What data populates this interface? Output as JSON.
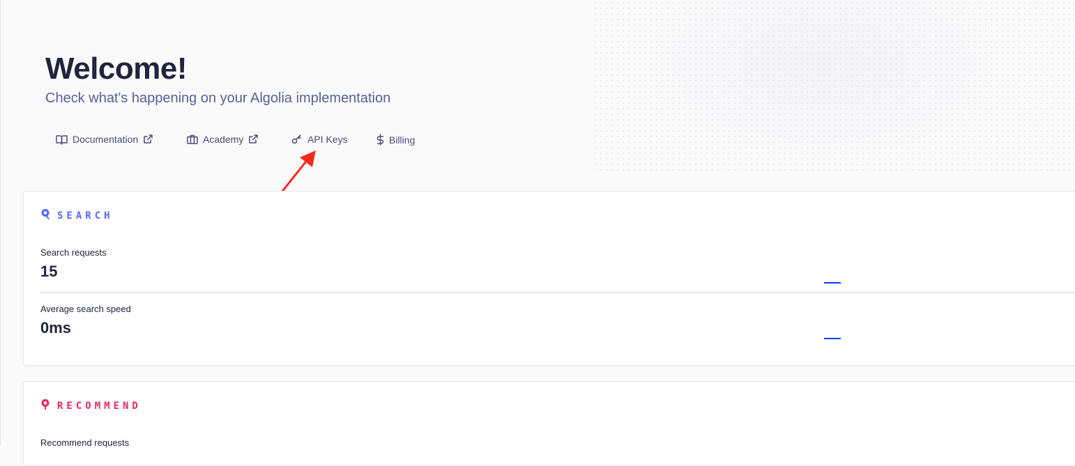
{
  "hero": {
    "title": "Welcome!",
    "subtitle": "Check what's happening on your Algolia implementation"
  },
  "quick_links": [
    {
      "label": "Documentation",
      "icon": "book-icon",
      "external": true
    },
    {
      "label": "Academy",
      "icon": "briefcase-icon",
      "external": true
    },
    {
      "label": "API Keys",
      "icon": "key-icon",
      "external": false
    },
    {
      "label": "Billing",
      "icon": "dollar-icon",
      "external": false
    }
  ],
  "search_card": {
    "title": "SEARCH",
    "icon": "search-pin-icon",
    "accent": "#5468ff",
    "metrics": [
      {
        "label": "Search requests",
        "value": "15"
      },
      {
        "label": "Average search speed",
        "value": "0ms"
      }
    ]
  },
  "recommend_card": {
    "title": "RECOMMEND",
    "icon": "recommend-pin-icon",
    "accent": "#e8295f",
    "metrics": [
      {
        "label": "Recommend requests"
      }
    ]
  },
  "annotation": {
    "icon": "red-arrow-annotation",
    "color": "#f52a1a"
  }
}
